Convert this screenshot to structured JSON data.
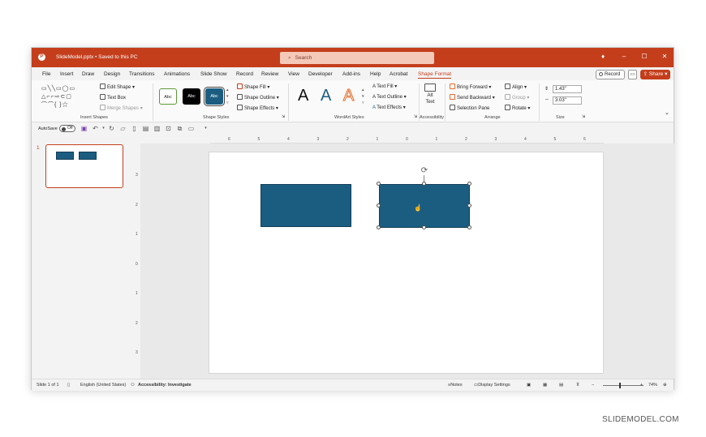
{
  "titlebar": {
    "file_title": "SlideModel.pptx • Saved to this PC",
    "search_placeholder": "Search"
  },
  "menu": {
    "items": [
      "File",
      "Insert",
      "Draw",
      "Design",
      "Transitions",
      "Animations",
      "Slide Show",
      "Record",
      "Review",
      "View",
      "Developer",
      "Add-ins",
      "Help",
      "Acrobat",
      "Shape Format"
    ],
    "active": "Shape Format",
    "record_label": "Record",
    "share_label": "Share"
  },
  "ribbon": {
    "insert_shapes": {
      "label": "Insert Shapes",
      "edit_shape": "Edit Shape",
      "text_box": "Text Box",
      "merge_shapes": "Merge Shapes"
    },
    "shape_styles": {
      "label": "Shape Styles",
      "swatches": [
        "Abc",
        "Abc",
        "Abc"
      ],
      "shape_fill": "Shape Fill",
      "shape_outline": "Shape Outline",
      "shape_effects": "Shape Effects"
    },
    "wordart_styles": {
      "label": "WordArt Styles",
      "glyph": "A",
      "text_fill": "Text Fill",
      "text_outline": "Text Outline",
      "text_effects": "Text Effects"
    },
    "accessibility": {
      "label": "Accessibility",
      "alt_text_line1": "Alt",
      "alt_text_line2": "Text"
    },
    "arrange": {
      "label": "Arrange",
      "bring_forward": "Bring Forward",
      "send_backward": "Send Backward",
      "selection_pane": "Selection Pane",
      "align": "Align",
      "group": "Group",
      "rotate": "Rotate"
    },
    "size": {
      "label": "Size",
      "height": "1.43\"",
      "width": "3.03\""
    }
  },
  "qat": {
    "autosave_label": "AutoSave",
    "toggle_state": "Off"
  },
  "thumbnails": {
    "slide_number": "1"
  },
  "ruler": {
    "h_ticks": [
      "6",
      "5",
      "4",
      "3",
      "2",
      "1",
      "0",
      "1",
      "2",
      "3",
      "4",
      "5",
      "6"
    ],
    "v_ticks": [
      "3",
      "2",
      "1",
      "0",
      "1",
      "2",
      "3"
    ]
  },
  "statusbar": {
    "slide_info": "Slide 1 of 1",
    "language": "English (United States)",
    "accessibility": "Accessibility: Investigate",
    "notes": "Notes",
    "display_settings": "Display Settings",
    "zoom": "74%"
  },
  "watermark": "SLIDEMODEL.COM",
  "colors": {
    "accent": "#c43e1c",
    "shape_fill": "#1b5d81"
  }
}
